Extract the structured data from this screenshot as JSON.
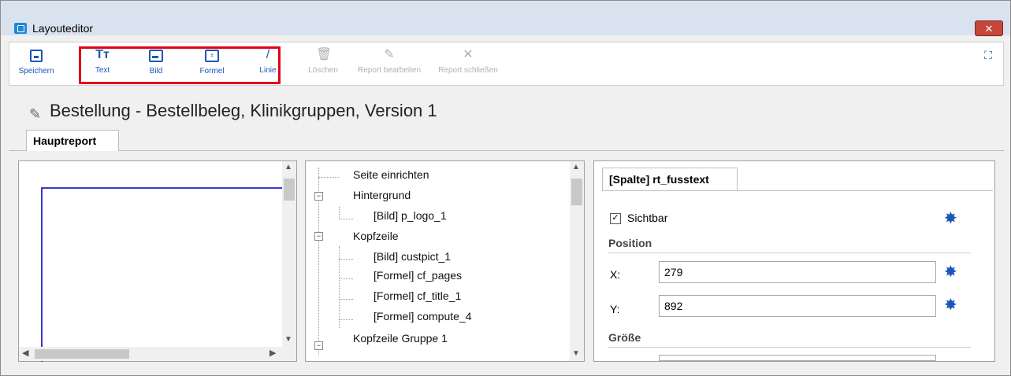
{
  "window": {
    "title": "Layouteditor",
    "close_label": "✕"
  },
  "toolbar": {
    "save": "Speichern",
    "text": "Text",
    "bild": "Bild",
    "formel": "Formel",
    "linie": "Linie",
    "loeschen": "Löschen",
    "report_bearbeiten": "Report bearbeiten",
    "report_schliessen": "Report schließen"
  },
  "header": {
    "title": "Bestellung - Bestellbeleg, Klinikgruppen, Version 1"
  },
  "tabs": [
    {
      "label": "Hauptreport"
    }
  ],
  "tree": {
    "items": [
      {
        "label": "Seite einrichten"
      },
      {
        "label": "Hintergrund"
      },
      {
        "label": "[Bild] p_logo_1"
      },
      {
        "label": "Kopfzeile"
      },
      {
        "label": "[Bild] custpict_1"
      },
      {
        "label": "[Formel] cf_pages"
      },
      {
        "label": "[Formel] cf_title_1"
      },
      {
        "label": "[Formel] compute_4"
      },
      {
        "label": "Kopfzeile Gruppe 1"
      }
    ]
  },
  "props": {
    "tab": "[Spalte] rt_fusstext",
    "visible_label": "Sichtbar",
    "visible_checked": true,
    "position_heading": "Position",
    "x_label": "X:",
    "x_value": "279",
    "y_label": "Y:",
    "y_value": "892",
    "size_heading": "Größe"
  },
  "icons": [
    "save-icon",
    "text-icon",
    "image-icon",
    "formula-icon",
    "line-icon",
    "delete-icon",
    "edit-icon",
    "close-icon",
    "fullscreen-icon",
    "pencil-icon",
    "magic-wand-icon"
  ],
  "colors": {
    "accent": "#1a57b8",
    "highlight_box": "#e2001a",
    "close_button": "#c7463a"
  }
}
